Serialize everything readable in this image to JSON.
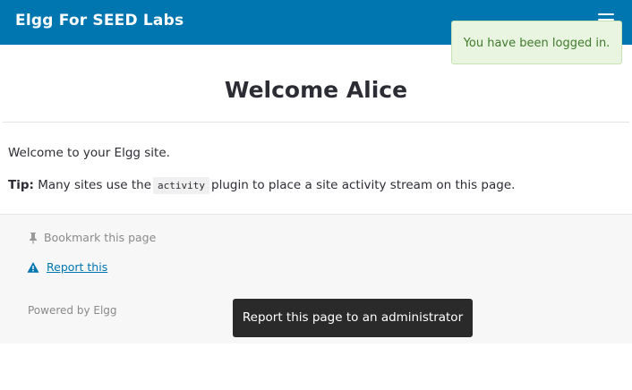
{
  "header": {
    "site_title": "Elgg For SEED Labs",
    "menu_icon": "hamburger-menu-icon",
    "background_color": "#0076b1"
  },
  "flash": {
    "message": "You have been logged in.",
    "status_color": "#3e7b2a"
  },
  "main": {
    "title": "Welcome Alice",
    "intro": "Welcome to your Elgg site.",
    "tip_label": "Tip:",
    "tip_before": "Many sites use the",
    "tip_code": "activity",
    "tip_after": "plugin to place a site activity stream on this page."
  },
  "footer": {
    "bookmark_label": "Bookmark this page",
    "bookmark_icon": "push-pin-icon",
    "report_label": "Report this",
    "report_icon": "warning-icon",
    "powered_by": "Powered by Elgg"
  },
  "tooltip": {
    "text": "Report this page to an administrator"
  }
}
